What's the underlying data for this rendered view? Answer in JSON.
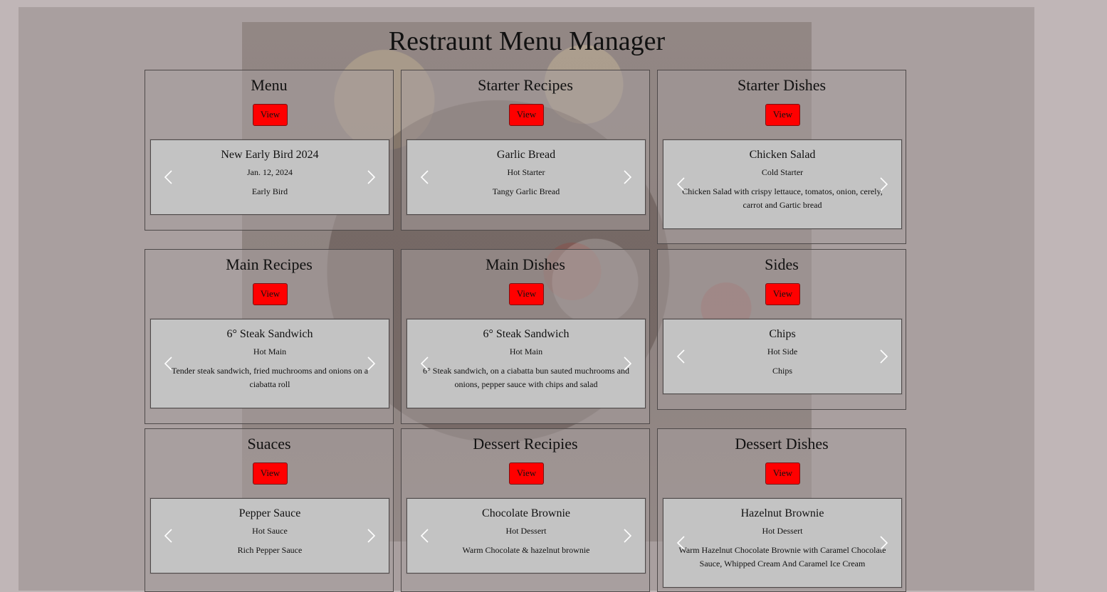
{
  "page": {
    "title": "Restraunt Menu Manager"
  },
  "button_label": "View",
  "cards": [
    {
      "title": "Menu",
      "item": {
        "name": "New Early Bird 2024",
        "sub": "Jan. 12, 2024",
        "desc": "Early Bird"
      }
    },
    {
      "title": "Starter Recipes",
      "item": {
        "name": "Garlic Bread",
        "sub": "Hot Starter",
        "desc": "Tangy Garlic Bread"
      }
    },
    {
      "title": "Starter Dishes",
      "item": {
        "name": "Chicken Salad",
        "sub": "Cold Starter",
        "desc": "Chicken Salad with crispy lettauce, tomatos, onion, cerely, carrot and Gartic bread"
      }
    },
    {
      "title": "Main Recipes",
      "item": {
        "name": "6° Steak Sandwich",
        "sub": "Hot Main",
        "desc": "Tender steak sandwich, fried muchrooms and onions on a ciabatta roll"
      }
    },
    {
      "title": "Main Dishes",
      "item": {
        "name": "6° Steak Sandwich",
        "sub": "Hot Main",
        "desc": "6° Steak sandwich, on a ciabatta bun sauted muchrooms and onions, pepper sauce with chips and salad"
      }
    },
    {
      "title": "Sides",
      "item": {
        "name": "Chips",
        "sub": "Hot Side",
        "desc": "Chips"
      }
    },
    {
      "title": "Suaces",
      "item": {
        "name": "Pepper Sauce",
        "sub": "Hot Sauce",
        "desc": "Rich Pepper Sauce"
      }
    },
    {
      "title": "Dessert Recipies",
      "item": {
        "name": "Chocolate Brownie",
        "sub": "Hot Dessert",
        "desc": "Warm Chocolate & hazelnut brownie"
      }
    },
    {
      "title": "Dessert Dishes",
      "item": {
        "name": "Hazelnut Brownie",
        "sub": "Hot Dessert",
        "desc": "Warm Hazelnut Chocolate Brownie with Caramel Chocolate Sauce, Whipped Cream And Caramel Ice Cream"
      }
    }
  ]
}
